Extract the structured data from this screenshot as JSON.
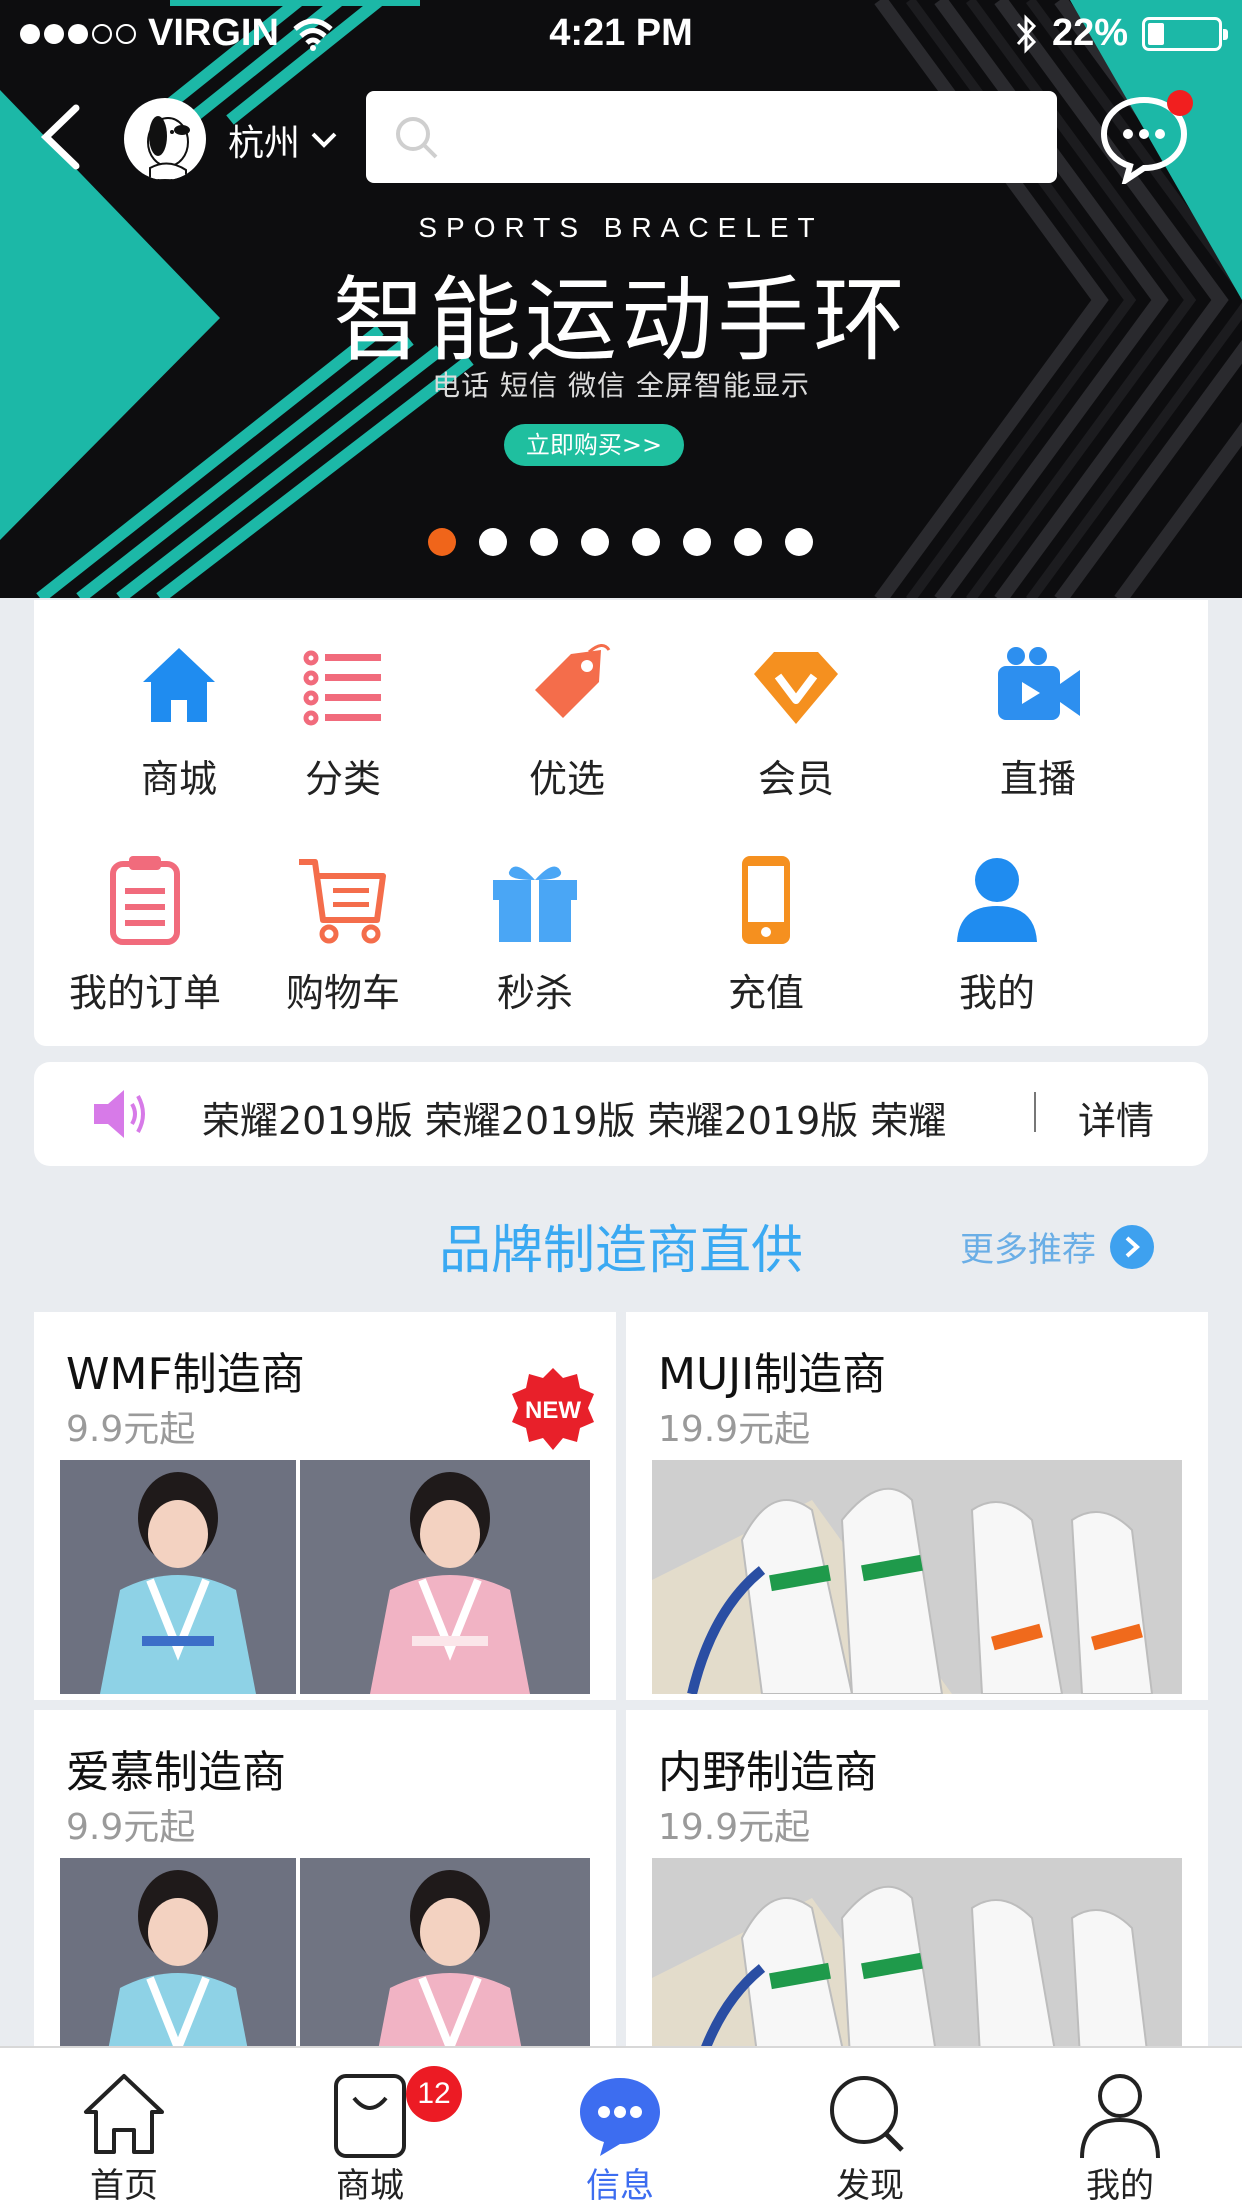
{
  "status_bar": {
    "carrier": "VIRGIN",
    "time": "4:21 PM",
    "battery": "22%",
    "battery_level": 0.22
  },
  "header": {
    "city": "杭州",
    "search_placeholder": ""
  },
  "banner": {
    "title_en": "SPORTS BRACELET",
    "title_cn": "智能运动手环",
    "subtitle": "电话 短信 微信 全屏智能显示",
    "cta": "立即购买>>",
    "slide_count": 8,
    "active_slide": 0,
    "accent_color": "#1fbfaa"
  },
  "menu": {
    "items": [
      {
        "label": "商城",
        "icon": "home-icon"
      },
      {
        "label": "分类",
        "icon": "list-icon"
      },
      {
        "label": "优选",
        "icon": "tag-icon"
      },
      {
        "label": "会员",
        "icon": "vip-icon"
      },
      {
        "label": "直播",
        "icon": "video-camera-icon"
      },
      {
        "label": "我的订单",
        "icon": "clipboard-icon"
      },
      {
        "label": "购物车",
        "icon": "cart-icon"
      },
      {
        "label": "秒杀",
        "icon": "gift-icon"
      },
      {
        "label": "充值",
        "icon": "phone-icon"
      },
      {
        "label": "我的",
        "icon": "user-icon"
      }
    ]
  },
  "notice": {
    "text": "荣耀2019版  荣耀2019版  荣耀2019版  荣耀",
    "detail": "详情"
  },
  "section": {
    "title": "品牌制造商直供",
    "more": "更多推荐"
  },
  "brands": [
    {
      "name": "WMF制造商",
      "price": "9.9元起",
      "badge": "NEW"
    },
    {
      "name": "MUJI制造商",
      "price": "19.9元起"
    },
    {
      "name": "爱慕制造商",
      "price": "9.9元起"
    },
    {
      "name": "内野制造商",
      "price": "19.9元起"
    }
  ],
  "tabbar": {
    "tabs": [
      {
        "label": "首页",
        "icon": "home-outline-icon"
      },
      {
        "label": "商城",
        "icon": "shopping-bag-icon",
        "badge": "12"
      },
      {
        "label": "信息",
        "icon": "chat-bubble-icon",
        "active": true
      },
      {
        "label": "发现",
        "icon": "search-icon"
      },
      {
        "label": "我的",
        "icon": "person-outline-icon"
      }
    ],
    "active_color": "#3d6df0"
  }
}
